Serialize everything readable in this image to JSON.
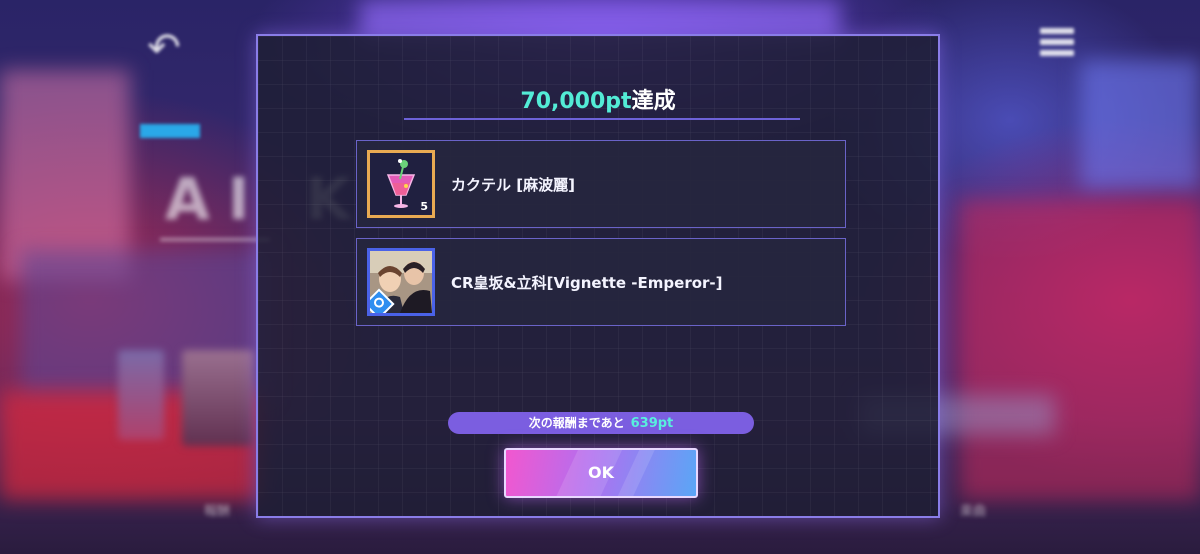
{
  "background": {
    "title_text": "AI KO",
    "bottom_left_label": "報酬",
    "bottom_right_label": "楽曲"
  },
  "dialog": {
    "title_points": "70,000pt",
    "title_suffix": "達成",
    "rewards": [
      {
        "name": "カクテル [麻波麗]",
        "quantity": "5",
        "icon": "cocktail-icon",
        "frame_color": "#e9aa52"
      },
      {
        "name": "CR皇坂&立科[Vignette -Emperor-]",
        "icon": "card-portrait",
        "frame_color": "#4a62e8"
      }
    ],
    "next_reward_label": "次の報酬まであと",
    "next_reward_points": "639pt",
    "ok_label": "OK"
  },
  "colors": {
    "accent_teal": "#53ecd6",
    "modal_border": "#8a7de8",
    "button_gradient_start": "#f257cf",
    "button_gradient_end": "#5aa6f6"
  }
}
